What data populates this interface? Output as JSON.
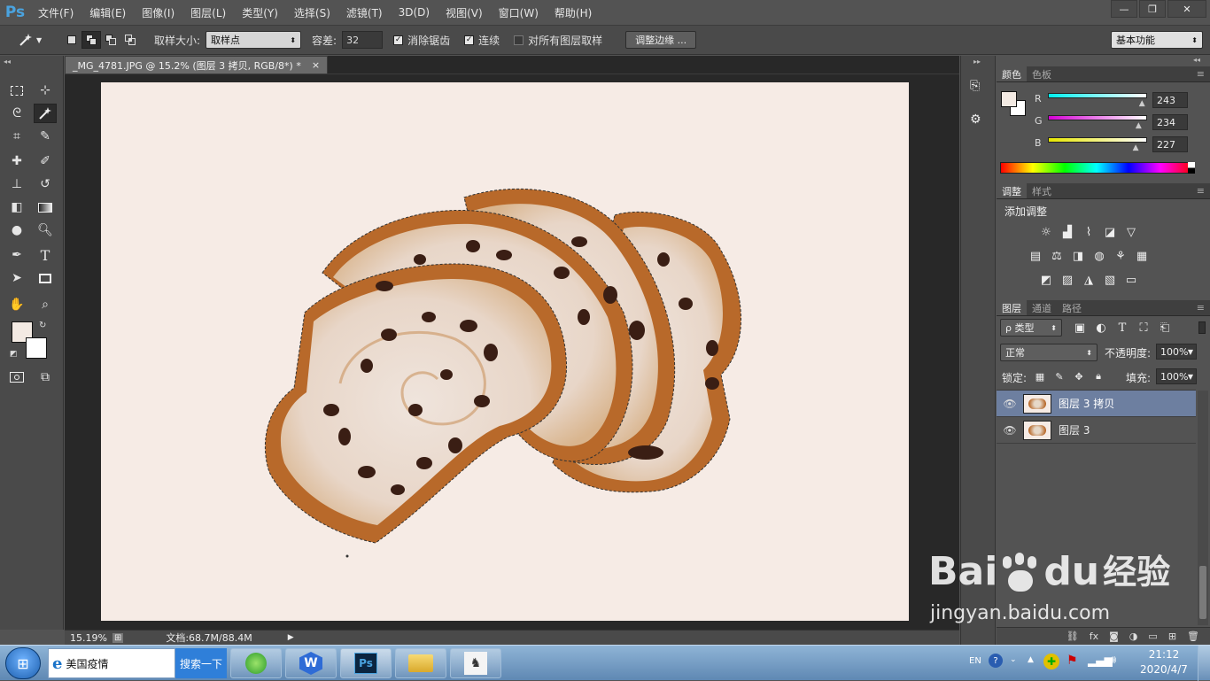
{
  "app": {
    "logo": "Ps"
  },
  "menu": [
    "文件(F)",
    "编辑(E)",
    "图像(I)",
    "图层(L)",
    "类型(Y)",
    "选择(S)",
    "滤镜(T)",
    "3D(D)",
    "视图(V)",
    "窗口(W)",
    "帮助(H)"
  ],
  "window_controls": {
    "minimize": "—",
    "restore": "❐",
    "close": "✕"
  },
  "options": {
    "sample_size_label": "取样大小:",
    "sample_size_value": "取样点",
    "tolerance_label": "容差:",
    "tolerance_value": "32",
    "antialias_label": "消除锯齿",
    "antialias_checked": true,
    "contiguous_label": "连续",
    "contiguous_checked": true,
    "sample_all_label": "对所有图层取样",
    "sample_all_checked": false,
    "refine_edge_button": "调整边缘 ...",
    "workspace_value": "基本功能"
  },
  "document": {
    "tab_title": "_MG_4781.JPG @ 15.2% (图层 3 拷贝, RGB/8*) *",
    "tab_close": "×",
    "zoom": "15.19%",
    "doc_info": "文档:68.7M/88.4M",
    "canvas_color": "#f6ebe5"
  },
  "color_panel": {
    "tabs": [
      "颜色",
      "色板"
    ],
    "r_label": "R",
    "r_value": "243",
    "g_label": "G",
    "g_value": "234",
    "b_label": "B",
    "b_value": "227",
    "r_fraction": 0.953,
    "g_fraction": 0.918,
    "b_fraction": 0.89,
    "foreground": "#f3eae3",
    "background": "#ffffff"
  },
  "adjustments_panel": {
    "tabs": [
      "调整",
      "样式"
    ],
    "title": "添加调整"
  },
  "layers_panel": {
    "tabs": [
      "图层",
      "通道",
      "路径"
    ],
    "filter_label": "ρ 类型",
    "blend_mode": "正常",
    "opacity_label": "不透明度:",
    "opacity_value": "100%",
    "lock_label": "锁定:",
    "fill_label": "填充:",
    "fill_value": "100%",
    "layers": [
      {
        "name": "图层 3 拷贝",
        "selected": true
      },
      {
        "name": "图层 3",
        "selected": false
      }
    ]
  },
  "taskbar": {
    "search_text": "美国疫情",
    "search_button": "搜索一下",
    "lang": "EN",
    "time": "21:12",
    "date": "2020/4/7"
  },
  "watermark": {
    "brand": "Bai",
    "brand2": "du",
    "suffix": "经验",
    "url": "jingyan.baidu.com"
  },
  "colors": {
    "accent_blue": "#4aa3df",
    "selected_layer": "#6d7fa0",
    "crust": "#b8692a"
  }
}
